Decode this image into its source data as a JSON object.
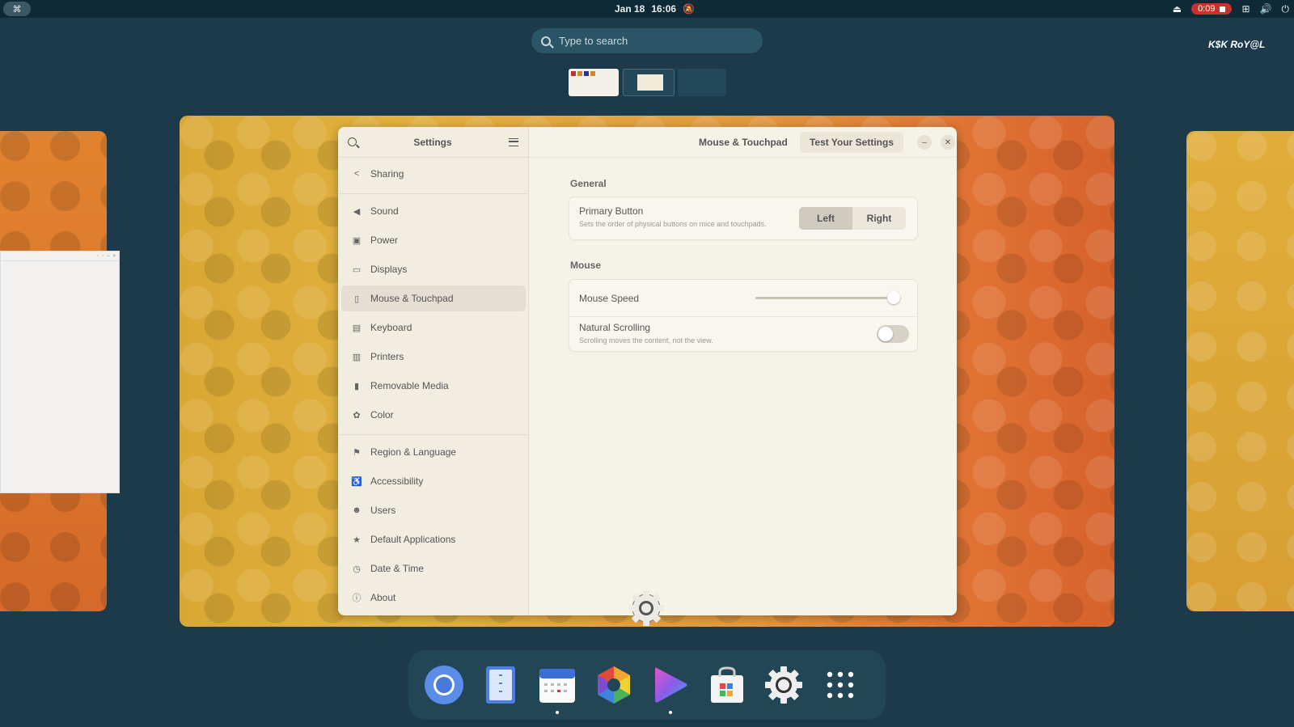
{
  "topbar": {
    "activities_glyph": "⌘",
    "date": "Jan 18",
    "time": "16:06",
    "recording_time": "0:09",
    "icons": [
      "notifications-off-icon",
      "eject-icon",
      "recording-icon",
      "network-icon",
      "volume-icon",
      "power-icon"
    ]
  },
  "search": {
    "placeholder": "Type to search"
  },
  "watermark": "K$K RoY@L",
  "settings": {
    "sidebar_title": "Settings",
    "items": [
      {
        "label": "Sharing",
        "icon": "share-icon"
      },
      {
        "label": "Sound",
        "icon": "speaker-icon"
      },
      {
        "label": "Power",
        "icon": "battery-icon"
      },
      {
        "label": "Displays",
        "icon": "monitor-icon"
      },
      {
        "label": "Mouse & Touchpad",
        "icon": "mouse-icon"
      },
      {
        "label": "Keyboard",
        "icon": "keyboard-icon"
      },
      {
        "label": "Printers",
        "icon": "printer-icon"
      },
      {
        "label": "Removable Media",
        "icon": "usb-icon"
      },
      {
        "label": "Color",
        "icon": "palette-icon"
      },
      {
        "label": "Region & Language",
        "icon": "flag-icon"
      },
      {
        "label": "Accessibility",
        "icon": "accessibility-icon"
      },
      {
        "label": "Users",
        "icon": "users-icon"
      },
      {
        "label": "Default Applications",
        "icon": "star-icon"
      },
      {
        "label": "Date & Time",
        "icon": "clock-icon"
      },
      {
        "label": "About",
        "icon": "info-icon"
      }
    ],
    "active_item": "Mouse & Touchpad",
    "page_title": "Mouse & Touchpad",
    "test_button": "Test Your Settings",
    "general": {
      "label": "General",
      "primary_button": {
        "title": "Primary Button",
        "subtitle": "Sets the order of physical buttons on mice and touchpads.",
        "options": [
          "Left",
          "Right"
        ],
        "selected": "Left"
      }
    },
    "mouse": {
      "label": "Mouse",
      "speed": {
        "title": "Mouse Speed",
        "value": 0.95
      },
      "natural_scrolling": {
        "title": "Natural Scrolling",
        "subtitle": "Scrolling moves the content, not the view.",
        "enabled": false
      }
    }
  },
  "dock": {
    "apps": [
      "chromium-icon",
      "text-editor-icon",
      "calendar-icon",
      "photos-icon",
      "video-player-icon",
      "software-store-icon",
      "settings-icon",
      "app-grid-icon"
    ]
  }
}
